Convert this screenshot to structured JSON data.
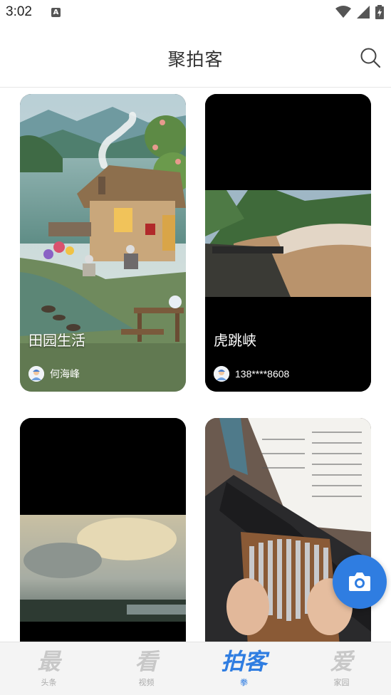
{
  "status_bar": {
    "time": "3:02"
  },
  "header": {
    "title": "聚拍客"
  },
  "cards": [
    {
      "title": "田园生活",
      "author": "何海峰"
    },
    {
      "title": "虎跳峡",
      "author": "138****8608"
    },
    {
      "title": "",
      "author": ""
    },
    {
      "title": "",
      "author": ""
    }
  ],
  "bottom_nav": [
    {
      "glyph": "最",
      "label": "头条"
    },
    {
      "glyph": "看",
      "label": "视频"
    },
    {
      "glyph": "拍客",
      "label": "拳"
    },
    {
      "glyph": "爱",
      "label": "家园"
    }
  ],
  "colors": {
    "accent": "#2f7de1",
    "inactive": "#c8c8c8"
  },
  "icons": [
    "search-icon",
    "camera-icon",
    "wifi-icon",
    "signal-icon",
    "battery-icon"
  ]
}
